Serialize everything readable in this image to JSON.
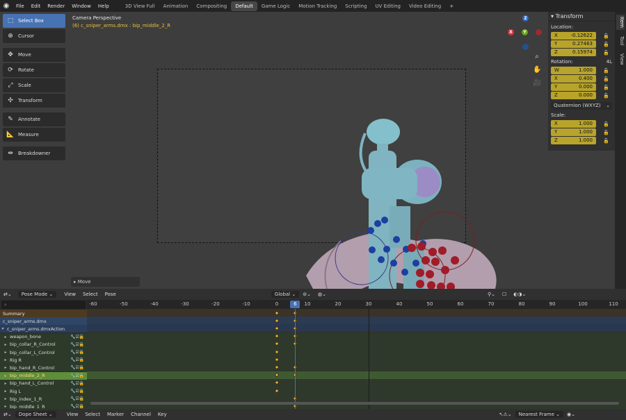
{
  "topbar": {
    "menus": [
      "File",
      "Edit",
      "Render",
      "Window",
      "Help"
    ],
    "workspaces": [
      "3D View Full",
      "Animation",
      "Compositing",
      "Default",
      "Game Logic",
      "Motion Tracking",
      "Scripting",
      "UV Editing",
      "Video Editing"
    ],
    "active_workspace": "Default",
    "add_label": "+"
  },
  "viewport": {
    "title": "Camera Perspective",
    "subtitle": "(6) c_sniper_arms.dmx : bip_middle_2_R",
    "last_operator": "Move",
    "gizmo": {
      "x": "X",
      "y": "Y",
      "z": "Z"
    }
  },
  "toolbar": {
    "tools": [
      {
        "label": "Select Box",
        "icon": "select-box-icon",
        "selected": true
      },
      {
        "label": "Cursor",
        "icon": "cursor-icon"
      },
      {
        "label": "Move",
        "icon": "move-icon"
      },
      {
        "label": "Rotate",
        "icon": "rotate-icon"
      },
      {
        "label": "Scale",
        "icon": "scale-icon"
      },
      {
        "label": "Transform",
        "icon": "transform-icon"
      },
      {
        "label": "Annotate",
        "icon": "annotate-icon"
      },
      {
        "label": "Measure",
        "icon": "measure-icon"
      },
      {
        "label": "Breakdowner",
        "icon": "breakdowner-icon"
      }
    ]
  },
  "npanel": {
    "header": "Transform",
    "location_label": "Location:",
    "location": [
      {
        "axis": "X",
        "value": "-0.12622"
      },
      {
        "axis": "Y",
        "value": "0.27463"
      },
      {
        "axis": "Z",
        "value": "0.15974"
      }
    ],
    "rotation_label": "Rotation:",
    "rotation_extra": "4L",
    "rotation": [
      {
        "axis": "W",
        "value": "1.000"
      },
      {
        "axis": "X",
        "value": "0.400"
      },
      {
        "axis": "Y",
        "value": "0.000"
      },
      {
        "axis": "Z",
        "value": "0.000"
      }
    ],
    "rotation_mode": "Quaternion (WXYZ)",
    "scale_label": "Scale:",
    "scale": [
      {
        "axis": "X",
        "value": "1.000"
      },
      {
        "axis": "Y",
        "value": "1.000"
      },
      {
        "axis": "Z",
        "value": "1.000"
      }
    ],
    "tabs": [
      "Item",
      "Tool",
      "View"
    ]
  },
  "dopesheet": {
    "header": {
      "mode": "Pose Mode",
      "menus": [
        "View",
        "Select",
        "Pose"
      ],
      "orientation": "Global"
    },
    "ruler": [
      "-60",
      "-50",
      "-40",
      "-30",
      "-20",
      "-10",
      "0",
      "10",
      "20",
      "30",
      "40",
      "50",
      "60",
      "70",
      "80",
      "90",
      "100",
      "110"
    ],
    "current_frame": "6",
    "channels": [
      {
        "name": "Summary",
        "kind": "summary"
      },
      {
        "name": "c_sniper_arms.dmx",
        "kind": "object"
      },
      {
        "name": "c_sniper_arms.dmxAction",
        "kind": "action"
      },
      {
        "name": "weapon_bone",
        "kind": "bone"
      },
      {
        "name": "bip_collar_R_Control",
        "kind": "bone"
      },
      {
        "name": "bip_collar_L_Control",
        "kind": "bone"
      },
      {
        "name": "Rig R",
        "kind": "bone"
      },
      {
        "name": "bip_hand_R_Control",
        "kind": "bone"
      },
      {
        "name": "bip_middle_2_R",
        "kind": "bone",
        "selected": true
      },
      {
        "name": "bip_hand_L_Control",
        "kind": "bone"
      },
      {
        "name": "Rig L",
        "kind": "bone"
      },
      {
        "name": "bip_index_1_R",
        "kind": "bone"
      },
      {
        "name": "bip_middle_1_R",
        "kind": "bone"
      }
    ],
    "footer": {
      "editor": "Dope Sheet",
      "menus": [
        "View",
        "Select",
        "Marker",
        "Channel",
        "Key"
      ],
      "snap": "Nearest Frame"
    }
  }
}
